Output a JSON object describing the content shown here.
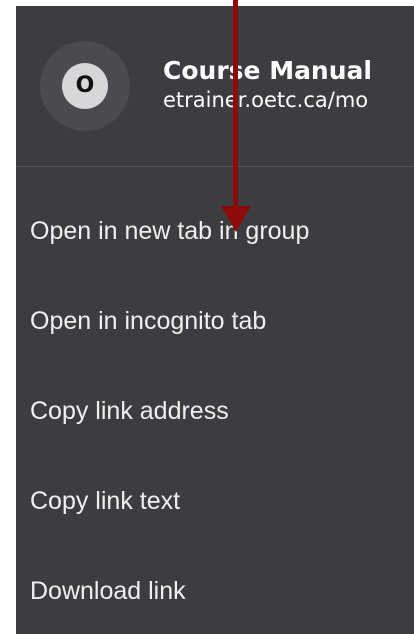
{
  "header": {
    "avatar_letter": "O",
    "title": "Course Manual",
    "url": "etrainer.oetc.ca/mo"
  },
  "menu": {
    "items": [
      {
        "label": "Open in new tab in group"
      },
      {
        "label": "Open in incognito tab"
      },
      {
        "label": "Copy link address"
      },
      {
        "label": "Copy link text"
      },
      {
        "label": "Download link"
      }
    ]
  },
  "colors": {
    "menu_background": "#3c3d41",
    "text": "#ffffff",
    "annotation_arrow": "#8b0a0a"
  },
  "icons": {
    "avatar": "site-favicon-letter",
    "annotation": "red-down-arrow-icon"
  }
}
